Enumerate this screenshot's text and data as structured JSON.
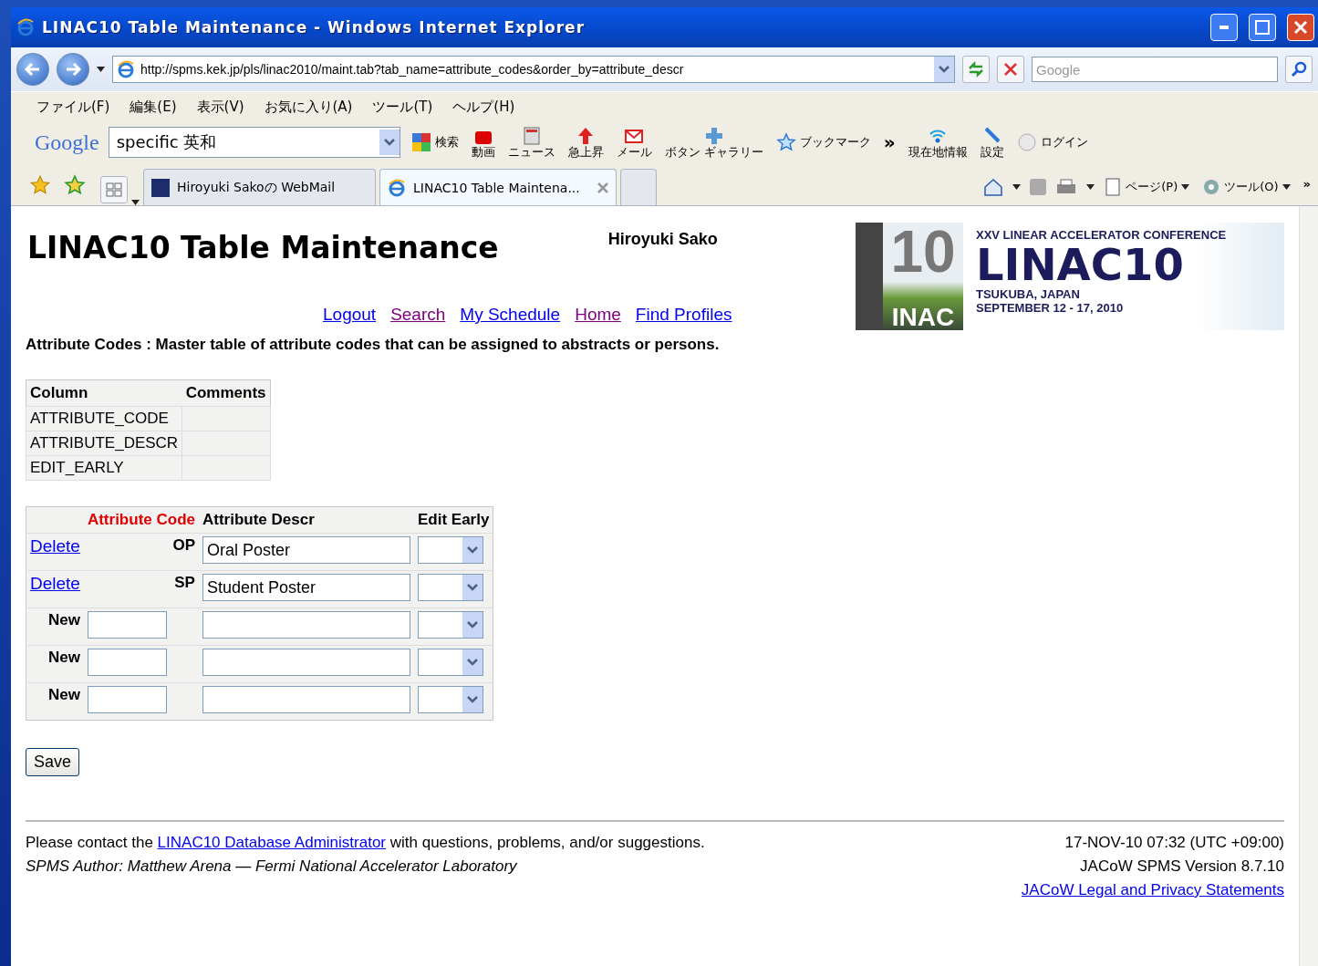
{
  "window": {
    "title": "LINAC10 Table Maintenance - Windows Internet Explorer"
  },
  "address_bar": {
    "url": "http://spms.kek.jp/pls/linac2010/maint.tab?tab_name=attribute_codes&order_by=attribute_descr",
    "search_placeholder": "Google"
  },
  "menu": [
    "ファイル(F)",
    "編集(E)",
    "表示(V)",
    "お気に入り(A)",
    "ツール(T)",
    "ヘルプ(H)"
  ],
  "google_toolbar": {
    "logo": "Google",
    "search_value": "specific  英和",
    "buttons": [
      {
        "kind": "search",
        "label": "検索"
      },
      {
        "kind": "video",
        "label": "動画"
      },
      {
        "kind": "news",
        "label": "ニュース"
      },
      {
        "kind": "trend",
        "label": "急上昇"
      },
      {
        "kind": "mail",
        "label": "メール"
      },
      {
        "kind": "gallery",
        "label": "ボタン ギャラリー"
      },
      {
        "kind": "bookmark",
        "label": "ブックマーク"
      },
      {
        "kind": "more",
        "label": "»"
      },
      {
        "kind": "location",
        "label": "現在地情報"
      },
      {
        "kind": "settings",
        "label": "設定"
      },
      {
        "kind": "login",
        "label": "ログイン"
      }
    ]
  },
  "tabs": [
    {
      "label": "Hiroyuki Sakoの WebMail",
      "selected": false
    },
    {
      "label": "LINAC10 Table Maintena...",
      "selected": true
    }
  ],
  "command_bar": {
    "items": [
      "ページ(P)",
      "ツール(O)"
    ],
    "more": "»"
  },
  "page": {
    "heading": "LINAC10 Table Maintenance",
    "user": "Hiroyuki Sako",
    "links": [
      {
        "label": "Logout",
        "visited": false
      },
      {
        "label": "Search",
        "visited": true
      },
      {
        "label": "My Schedule",
        "visited": false
      },
      {
        "label": "Home",
        "visited": true
      },
      {
        "label": "Find Profiles",
        "visited": false
      }
    ],
    "banner": {
      "mark_number": "10",
      "mark_word": "INAC",
      "subtitle": "XXV LINEAR ACCELERATOR CONFERENCE",
      "title": "LINAC10",
      "place": "TSUKUBA, JAPAN",
      "dates": "SEPTEMBER 12 - 17, 2010"
    },
    "description": "Attribute Codes :  Master table of attribute codes that can be assigned to abstracts or persons.",
    "columns_table": {
      "headers": [
        "Column",
        "Comments"
      ],
      "rows": [
        "ATTRIBUTE_CODE",
        "ATTRIBUTE_DESCR",
        "EDIT_EARLY"
      ]
    },
    "edit_table": {
      "headers": [
        {
          "label": "Attribute Code",
          "sorted": true
        },
        {
          "label": "Attribute Descr",
          "sorted": false
        },
        {
          "label": "Edit Early",
          "sorted": false
        }
      ],
      "rows": [
        {
          "kind": "existing",
          "action": "Delete",
          "code": "OP",
          "descr": "Oral Poster"
        },
        {
          "kind": "existing",
          "action": "Delete",
          "code": "SP",
          "descr": "Student Poster"
        },
        {
          "kind": "new",
          "label": "New"
        },
        {
          "kind": "new",
          "label": "New"
        },
        {
          "kind": "new",
          "label": "New"
        }
      ]
    },
    "save": "Save",
    "footer": {
      "contact_before": "Please contact the ",
      "contact_link": "LINAC10 Database Administrator",
      "contact_after": " with questions, problems, and/or suggestions.",
      "author": "SPMS Author:  Matthew Arena — Fermi National Accelerator Laboratory",
      "timestamp": "17-NOV-10 07:32 (UTC +09:00)",
      "version": "JACoW SPMS Version 8.7.10",
      "legal": "JACoW Legal and Privacy Statements"
    }
  }
}
